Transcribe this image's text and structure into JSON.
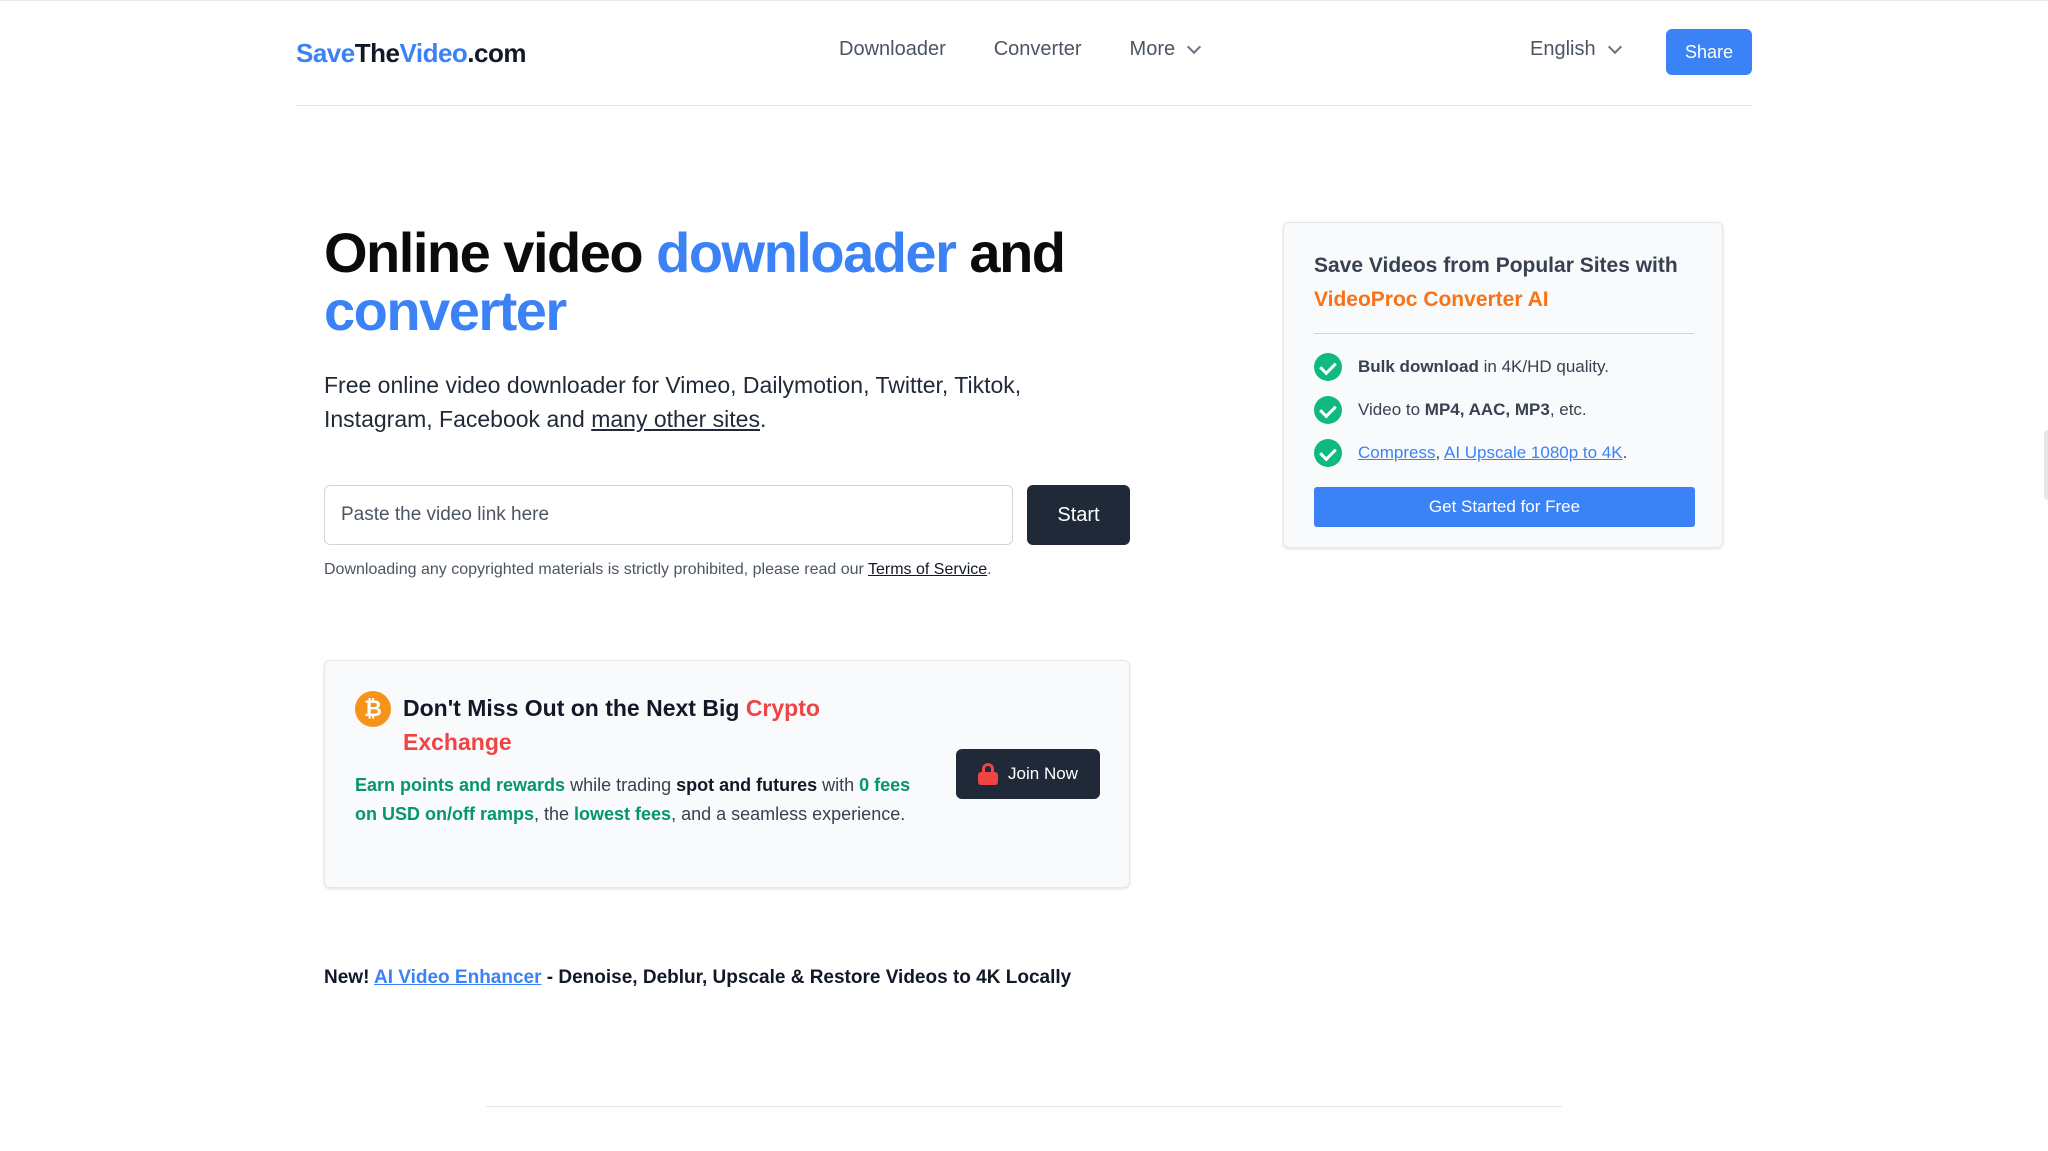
{
  "header": {
    "logo": {
      "part1": "Save",
      "part2": "The",
      "part3": "Video",
      "part4": ".com"
    },
    "nav": [
      {
        "label": "Downloader"
      },
      {
        "label": "Converter"
      },
      {
        "label": "More"
      }
    ],
    "language": "English",
    "share_label": "Share"
  },
  "hero": {
    "title_part1": "Online video ",
    "title_highlight1": "downloader",
    "title_part2": " and",
    "title_highlight2": "converter",
    "subtitle_text": "Free online video downloader for Vimeo, Dailymotion, Twitter, Tiktok, Instagram, Facebook and ",
    "subtitle_link": "many other sites",
    "subtitle_end": ".",
    "input_placeholder": "Paste the video link here",
    "start_label": "Start",
    "disclaimer_text": "Downloading any copyrighted materials is strictly prohibited, please read our ",
    "disclaimer_link": "Terms of Service",
    "disclaimer_end": "."
  },
  "crypto": {
    "icon_glyph": "₿",
    "title_part1": "Don't Miss Out on the Next Big ",
    "title_highlight": "Crypto Exchange",
    "desc": {
      "p1": "Earn points and rewards",
      "p2": " while trading ",
      "p3": "spot and futures",
      "p4": " with ",
      "p5": "0 fees on USD on/off ramps",
      "p6": ", the ",
      "p7": "lowest fees",
      "p8": ", and a seamless experience."
    },
    "join_label": "Join Now"
  },
  "ai_line": {
    "prefix": "New! ",
    "link": "AI Video Enhancer",
    "suffix": " - Denoise, Deblur, Upscale & Restore Videos to 4K Locally"
  },
  "side_card": {
    "title_part1": "Save Videos from Popular Sites with",
    "title_highlight": "VideoProc Converter AI",
    "features": [
      {
        "bold": "Bulk download",
        "text": " in 4K/HD quality."
      },
      {
        "pre": "Video to ",
        "bold": "MP4, AAC, MP3",
        "text": ", etc."
      },
      {
        "link1": "Compress",
        "sep": ", ",
        "link2": "AI Upscale 1080p to 4K",
        "end": "."
      }
    ],
    "cta_label": "Get Started for Free"
  },
  "colors": {
    "accent": "#3b82f6",
    "dark_button": "#1f2937",
    "crypto_red": "#ef4444",
    "green": "#059669",
    "orange": "#f97316",
    "check_green": "#10b981"
  }
}
